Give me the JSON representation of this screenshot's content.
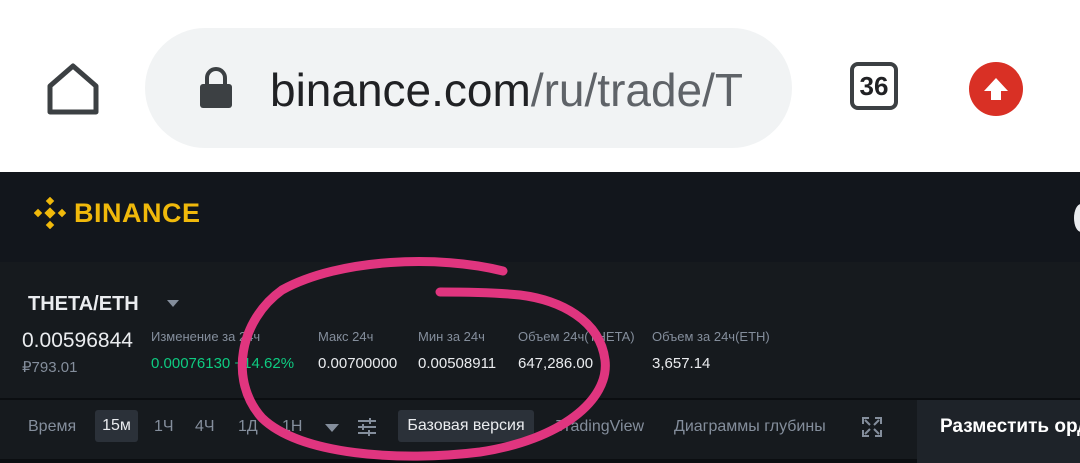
{
  "browser": {
    "url_host": "binance.com",
    "url_path": "/ru/trade/T",
    "tab_count": "36",
    "icons": [
      "home-icon",
      "lock-icon",
      "tab-switcher-icon",
      "update-arrow-icon"
    ]
  },
  "header": {
    "logo_text": "BINANCE",
    "logo_icon": "binance-diamond-icon",
    "accent_color": "#f0b90b"
  },
  "ticker": {
    "pair": "THETA/ETH",
    "last_price": "0.00596844",
    "fiat_price": "₽793.01",
    "stats": [
      {
        "label": "Изменение за 24ч",
        "value": "0.00076130",
        "extra": "+14.62%"
      },
      {
        "label": "Макс 24ч",
        "value": "0.00700000"
      },
      {
        "label": "Мин за 24ч",
        "value": "0.00508911"
      },
      {
        "label": "Объем 24ч(THETA)",
        "value": "647,286.00"
      },
      {
        "label": "Объем за 24ч(ETH)",
        "value": "3,657.14"
      }
    ],
    "positive_color": "#0ecb81"
  },
  "toolbar": {
    "time_label": "Время",
    "intervals": [
      "15м",
      "1Ч",
      "4Ч",
      "1Д",
      "1Н"
    ],
    "active_interval": "15м",
    "basic_view": "Базовая версия",
    "tradingview": "TradingView",
    "depth_chart": "Диаграммы глубины",
    "place_order": "Разместить ордер"
  },
  "annotation": {
    "color": "#e0357f",
    "shape": "hand-drawn-circle"
  }
}
